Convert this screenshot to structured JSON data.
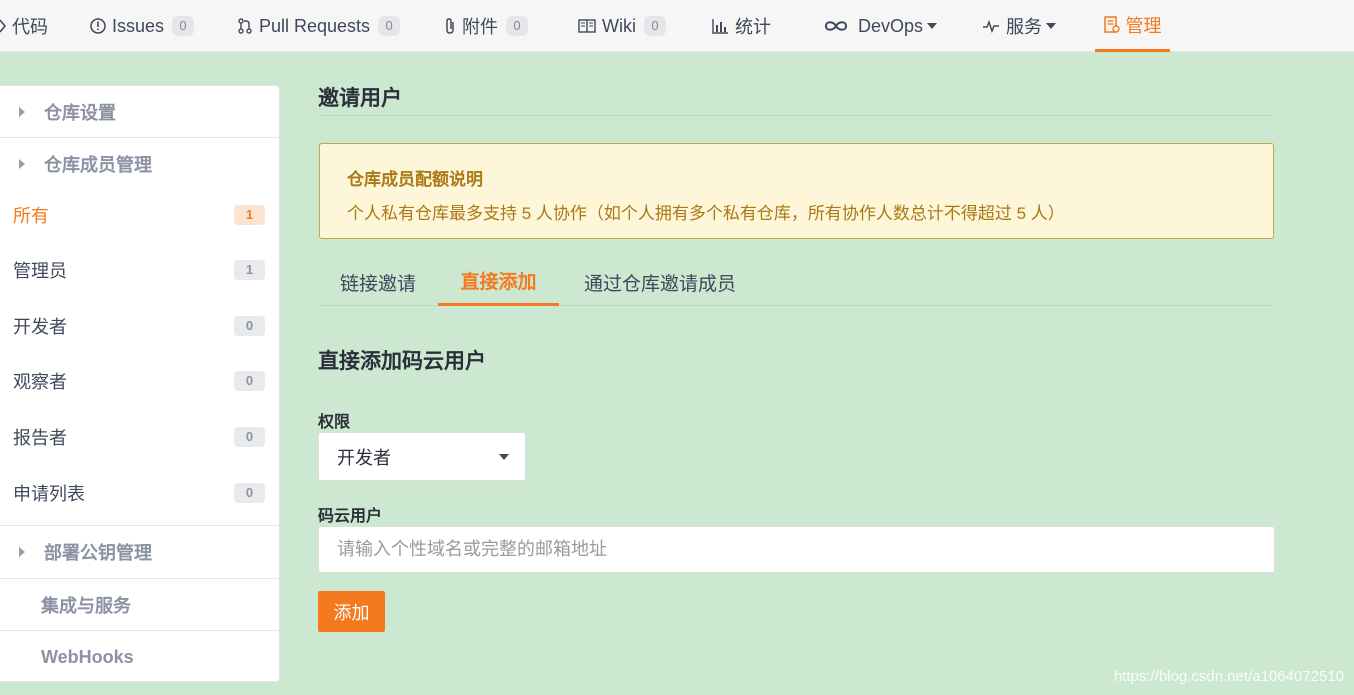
{
  "topnav": {
    "items": [
      {
        "label": "代码",
        "icon": "code-icon"
      },
      {
        "label": "Issues",
        "badge": "0",
        "icon": "issue-icon"
      },
      {
        "label": "Pull Requests",
        "badge": "0",
        "icon": "pull-request-icon"
      },
      {
        "label": "附件",
        "badge": "0",
        "icon": "paperclip-icon"
      },
      {
        "label": "Wiki",
        "badge": "0",
        "icon": "book-icon"
      },
      {
        "label": "统计",
        "icon": "bar-chart-icon"
      },
      {
        "label": "DevOps",
        "icon": "infinity-icon"
      },
      {
        "label": "服务",
        "icon": "pulse-icon"
      },
      {
        "label": "管理",
        "icon": "manage-icon",
        "active": true
      }
    ]
  },
  "sidebar": {
    "sections": {
      "repo_settings": "仓库设置",
      "member_mgmt": "仓库成员管理",
      "deploy_keys": "部署公钥管理",
      "integrations": "集成与服务",
      "webhooks": "WebHooks"
    },
    "members": [
      {
        "label": "所有",
        "count": "1",
        "active": true
      },
      {
        "label": "管理员",
        "count": "1"
      },
      {
        "label": "开发者",
        "count": "0"
      },
      {
        "label": "观察者",
        "count": "0"
      },
      {
        "label": "报告者",
        "count": "0"
      },
      {
        "label": "申请列表",
        "count": "0"
      }
    ]
  },
  "main": {
    "title": "邀请用户",
    "notice": {
      "title": "仓库成员配额说明",
      "text": "个人私有仓库最多支持 5 人协作（如个人拥有多个私有仓库，所有协作人数总计不得超过 5 人）"
    },
    "tabs": [
      {
        "label": "链接邀请"
      },
      {
        "label": "直接添加",
        "active": true
      },
      {
        "label": "通过仓库邀请成员"
      }
    ],
    "section_title": "直接添加码云用户",
    "permission_label": "权限",
    "permission_value": "开发者",
    "user_label": "码云用户",
    "user_placeholder": "请输入个性域名或完整的邮箱地址",
    "add_button": "添加"
  },
  "watermark": "https://blog.csdn.net/a1064072510",
  "colors": {
    "accent": "#f4791f",
    "background": "#cce8d0",
    "notice_bg": "#fef6d8",
    "notice_text": "#a97a16"
  }
}
